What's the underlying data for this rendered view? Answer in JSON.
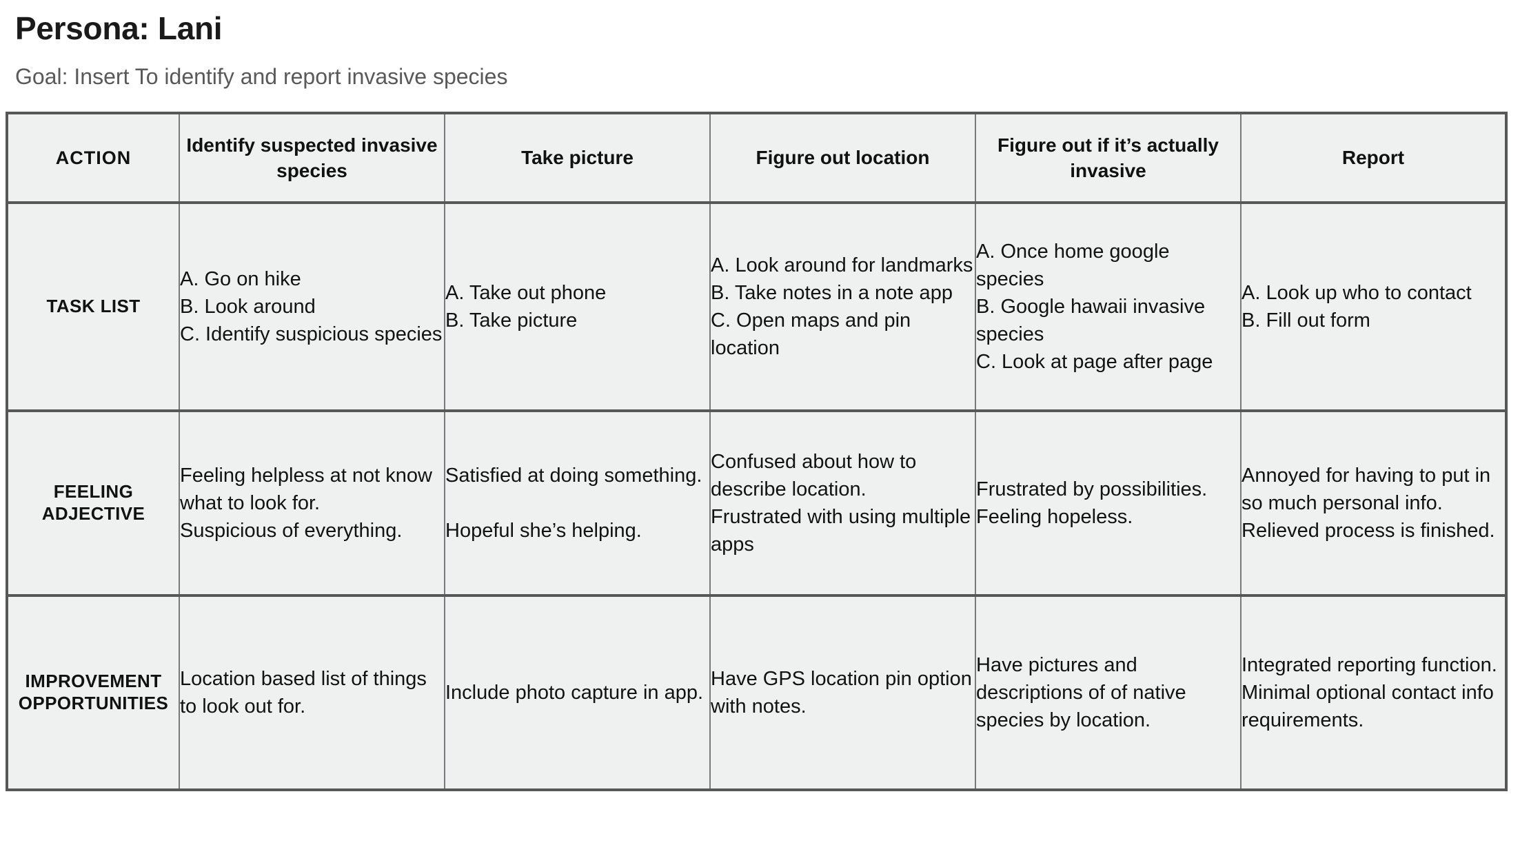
{
  "header": {
    "persona_title": "Persona: Lani",
    "goal_label": "Goal: Insert To identify and report invasive species"
  },
  "table": {
    "row_label_column_header": "ACTION",
    "stages": [
      "Identify suspected invasive species",
      "Take picture",
      "Figure out location",
      "Figure out if it’s actually invasive",
      "Report"
    ],
    "rows": [
      {
        "label": "TASK LIST",
        "cells": [
          "A. Go on hike\nB. Look around\nC. Identify suspicious species",
          "A. Take out phone\nB. Take picture",
          "A. Look around for landmarks\nB. Take notes in a note app\nC. Open maps and pin location",
          "A. Once home google species\nB. Google hawaii invasive species\nC. Look at page after page",
          "A. Look up who to contact\nB. Fill out form"
        ]
      },
      {
        "label": "FEELING ADJECTIVE",
        "cells": [
          "Feeling helpless at not know what to look for.\nSuspicious of everything.",
          "Satisfied at doing something.\n\nHopeful she’s helping.",
          "Confused about how to describe location.\nFrustrated with using multiple apps",
          "Frustrated by possibilities.\nFeeling hopeless.",
          "Annoyed for having to put in so much personal info.\nRelieved process is finished."
        ]
      },
      {
        "label": "IMPROVEMENT OPPORTUNITIES",
        "cells": [
          "Location based list of things to look out for.",
          "Include photo capture in app.",
          "Have GPS location pin option with notes.",
          "Have pictures and descriptions of of native species by location.",
          "Integrated reporting function. Minimal optional contact info requirements."
        ]
      }
    ]
  },
  "colors": {
    "stage_header_blue": "#d4e1f6",
    "cell_gray": "#eff0f0",
    "border_dark": "#575757",
    "border_light": "#9a9da2"
  }
}
